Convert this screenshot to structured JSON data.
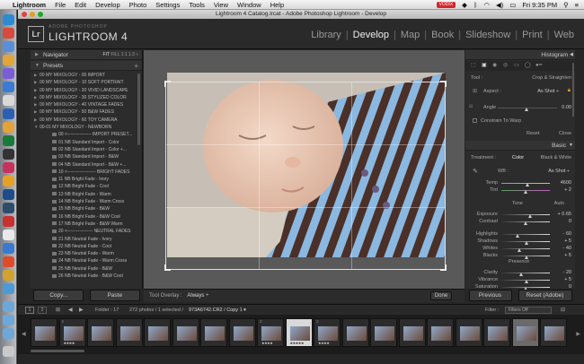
{
  "menubar": {
    "apple": "",
    "items": [
      "Lightroom",
      "File",
      "Edit",
      "Develop",
      "Photo",
      "Settings",
      "Tools",
      "View",
      "Window",
      "Help"
    ],
    "adobe_badge": "VODIX",
    "time": "Fri 9:35 PM"
  },
  "window": {
    "title": "Lightroom 4 Catalog.lrcat - Adobe Photoshop Lightroom - Develop"
  },
  "identity": {
    "logo": "Lr",
    "brand_small": "ADOBE PHOTOSHOP",
    "brand_big": "LIGHTROOM 4"
  },
  "modules": [
    "Library",
    "Develop",
    "Map",
    "Book",
    "Slideshow",
    "Print",
    "Web"
  ],
  "active_module": "Develop",
  "left_panel": {
    "navigator_label": "Navigator",
    "zoom_options": [
      "FIT",
      "FILL",
      "1:1",
      "1:3 ÷"
    ],
    "presets_label": "Presets",
    "presets_add": "+",
    "presets": [
      {
        "label": "00 MY MIXOLOGY - 00 IMPORT",
        "kind": "folder"
      },
      {
        "label": "00 MY MIXOLOGY - 10 SOFT PORTRAIT",
        "kind": "folder"
      },
      {
        "label": "00 MY MIXOLOGY - 20 VIVID LANDSCAPE",
        "kind": "folder"
      },
      {
        "label": "00 MY MIXOLOGY - 30 STYLIZED COLOR",
        "kind": "folder"
      },
      {
        "label": "00 MY MIXOLOGY - 40 VINTAGE FADES",
        "kind": "folder"
      },
      {
        "label": "00 MY MIXOLOGY - 50 B&W FADES",
        "kind": "folder"
      },
      {
        "label": "00 MY MIXOLOGY - 60 TOY CAMERA",
        "kind": "folder"
      },
      {
        "label": "00-01 MY MIXOLOGY - NEWBORN",
        "kind": "open"
      },
      {
        "label": "00 <---------------- IMPORT PRESET...",
        "kind": "item"
      },
      {
        "label": "01 NB Standard Import - Color",
        "kind": "item"
      },
      {
        "label": "02 NB Standard Import - Color +...",
        "kind": "item"
      },
      {
        "label": "03 NB Standard Import - B&W",
        "kind": "item"
      },
      {
        "label": "04 NB Standard Import - B&W +...",
        "kind": "item"
      },
      {
        "label": "10 <------------------- BRIGHT FADES",
        "kind": "item"
      },
      {
        "label": "11 NB Bright Fade - Ivory",
        "kind": "item"
      },
      {
        "label": "12 NB Bright Fade - Cool",
        "kind": "item"
      },
      {
        "label": "13 NB Bright Fade - Warm",
        "kind": "item"
      },
      {
        "label": "14 NB Bright Fade - Warm Cross",
        "kind": "item"
      },
      {
        "label": "15 NB Bright Fade - B&W",
        "kind": "item"
      },
      {
        "label": "16 NB Bright Fade - B&W Cool",
        "kind": "item"
      },
      {
        "label": "17 NB Bright Fade - B&W Warm",
        "kind": "item"
      },
      {
        "label": "20 <----------------- NEUTRAL FADES",
        "kind": "item"
      },
      {
        "label": "21 NB Neutral Fade - Ivory",
        "kind": "item"
      },
      {
        "label": "22 NB Neutral Fade - Cool",
        "kind": "item"
      },
      {
        "label": "23 NB Neutral Fade - Warm",
        "kind": "item"
      },
      {
        "label": "24 NB Neutral Fade - Warm Cross",
        "kind": "item"
      },
      {
        "label": "25 NB Neutral Fade - B&W",
        "kind": "item"
      },
      {
        "label": "26 NB Neutral Fade - B&W Cool",
        "kind": "item"
      }
    ],
    "copy_button": "Copy...",
    "paste_button": "Paste"
  },
  "toolbar": {
    "overlay_label": "Tool Overlay :",
    "overlay_value": "Always ÷",
    "done_button": "Done"
  },
  "right_panel": {
    "histogram_label": "Histogram",
    "crop_title": "Crop & Straighten",
    "tool_label": "Tool :",
    "aspect_label": "Aspect :",
    "aspect_value": "As Shot ÷",
    "angle_label": "Angle",
    "angle_value": "0.00",
    "constrain_label": "Constrain To Warp",
    "reset_label": "Reset",
    "close_label": "Close",
    "basic_label": "Basic",
    "treatment_label": "Treatment :",
    "treatment_color": "Color",
    "treatment_bw": "Black & White",
    "wb_label": "WB :",
    "wb_value": "As Shot ÷",
    "temp_label": "Temp",
    "temp_value": "4600",
    "tint_label": "Tint",
    "tint_value": "+ 2",
    "tone_label": "Tone",
    "auto_label": "Auto",
    "exposure_label": "Exposure",
    "exposure_value": "+ 0.65",
    "contrast_label": "Contrast",
    "contrast_value": "0",
    "highlights_label": "Highlights",
    "highlights_value": "- 60",
    "shadows_label": "Shadows",
    "shadows_value": "+ 5",
    "whites_label": "Whites",
    "whites_value": "- 40",
    "blacks_label": "Blacks",
    "blacks_value": "+ 5",
    "presence_label": "Presence",
    "clarity_label": "Clarity",
    "clarity_value": "- 20",
    "vibrance_label": "Vibrance",
    "vibrance_value": "+ 5",
    "saturation_label": "Saturation",
    "saturation_value": "0",
    "previous_button": "Previous",
    "reset_button": "Reset (Adobe)"
  },
  "filmstrip_bar": {
    "btn1": "1",
    "btn2": "2",
    "folder_label": "Folder : 17",
    "photo_count": "272 photos / 1 selected /",
    "filename": "973A6742.CR2 / Copy 1 ▾",
    "filter_label": "Filter :",
    "filter_value": "Filters Off"
  },
  "filmstrip": [
    {
      "num": "",
      "stars": "",
      "sel": false
    },
    {
      "num": "2",
      "stars": "★★★★",
      "sel": false
    },
    {
      "num": "",
      "stars": "",
      "sel": false
    },
    {
      "num": "",
      "stars": "",
      "sel": false
    },
    {
      "num": "",
      "stars": "",
      "sel": false
    },
    {
      "num": "",
      "stars": "",
      "sel": false
    },
    {
      "num": "",
      "stars": "",
      "sel": false
    },
    {
      "num": "",
      "stars": "",
      "sel": false
    },
    {
      "num": "2",
      "stars": "★★★★",
      "sel": false
    },
    {
      "num": "",
      "stars": "★★★★★",
      "sel": true
    },
    {
      "num": "2",
      "stars": "★★★★",
      "sel": false
    },
    {
      "num": "",
      "stars": "",
      "sel": false
    },
    {
      "num": "",
      "stars": "",
      "sel": false
    },
    {
      "num": "",
      "stars": "",
      "sel": false
    },
    {
      "num": "",
      "stars": "",
      "sel": false
    },
    {
      "num": "",
      "stars": "",
      "sel": false
    },
    {
      "num": "",
      "stars": "",
      "sel": false
    },
    {
      "num": "",
      "stars": "",
      "sel": true
    },
    {
      "num": "",
      "stars": "",
      "sel": false
    }
  ]
}
